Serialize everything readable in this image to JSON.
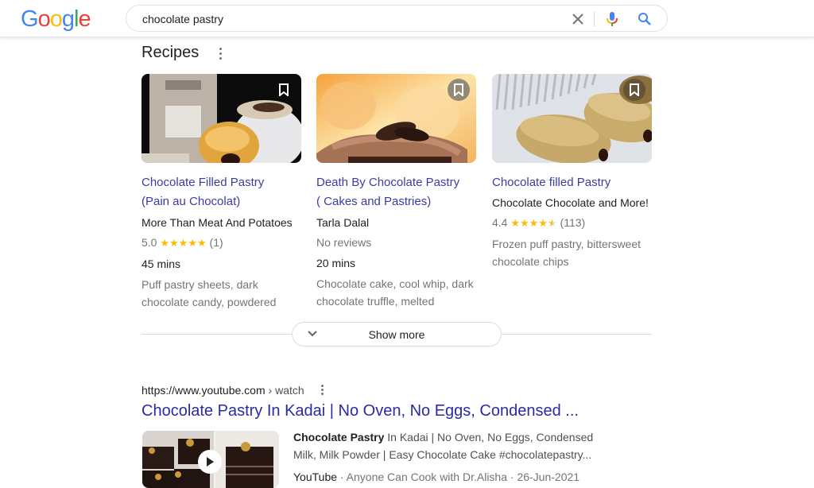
{
  "header": {
    "logo": {
      "letters": [
        {
          "ch": "G",
          "color": "#4285f4"
        },
        {
          "ch": "o",
          "color": "#ea4335"
        },
        {
          "ch": "o",
          "color": "#fbbc05"
        },
        {
          "ch": "g",
          "color": "#4285f4"
        },
        {
          "ch": "l",
          "color": "#34a853"
        },
        {
          "ch": "e",
          "color": "#ea4335"
        }
      ]
    },
    "search_value": "chocolate pastry",
    "icons": {
      "clear": "close-icon",
      "mic": "microphone-icon",
      "search": "search-icon"
    }
  },
  "recipes": {
    "title": "Recipes",
    "cards": [
      {
        "title_line1": "Chocolate Filled Pastry",
        "title_line2": "(Pain au Chocolat)",
        "source": "More Than Meat And Potatoes",
        "rating": "5.0",
        "stars": "★★★★★",
        "reviews": "(1)",
        "time": "45 mins",
        "ingredients_line1": "Puff pastry sheets, dark",
        "ingredients_line2": "chocolate candy, powdered"
      },
      {
        "title_line1": "Death By Chocolate Pastry",
        "title_line2": "( Cakes and Pastries)",
        "source": "Tarla Dalal",
        "rating_text": "No reviews",
        "time": "20 mins",
        "ingredients_line1": "Chocolate cake, cool whip, dark",
        "ingredients_line2": "chocolate truffle, melted"
      },
      {
        "title_line1": "Chocolate filled Pastry",
        "source": "Chocolate Chocolate and More!",
        "rating": "4.4",
        "stars": "★★★★",
        "half_star": "★",
        "reviews": "(113)",
        "ingredients_line1": "Frozen puff pastry, bittersweet",
        "ingredients_line2": "chocolate chips"
      }
    ],
    "show_more": "Show more"
  },
  "result": {
    "url": "https://www.youtube.com",
    "crumb": " › watch",
    "title": "Chocolate Pastry In Kadai | No Oven, No Eggs, Condensed ...",
    "snippet_bold": "Chocolate Pastry",
    "snippet_rest": " In Kadai | No Oven, No Eggs, Condensed Milk, Milk Powder | Easy Chocolate Cake #chocolatepastry...",
    "meta_source": "YouTube",
    "meta_rest": " · Anyone Can Cook with Dr.Alisha · 26-Jun-2021"
  }
}
